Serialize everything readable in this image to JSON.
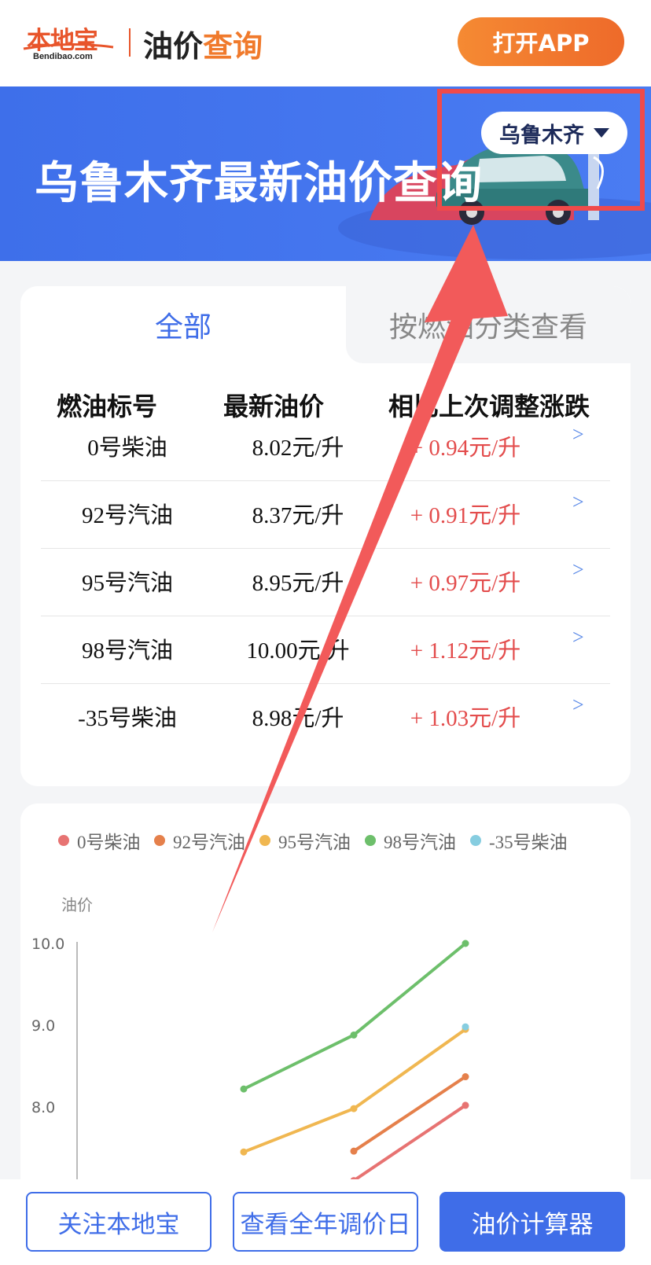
{
  "header": {
    "logo_text": "本地宝",
    "logo_sub": "Bendibao.com",
    "title_plain": "油价",
    "title_accent": "查询",
    "open_app_label": "打开APP"
  },
  "banner": {
    "title": "乌鲁木齐最新油价查询",
    "city_select": "乌鲁木齐"
  },
  "tabs": [
    {
      "label": "全部",
      "active": true
    },
    {
      "label": "按燃油分类查看",
      "active": false
    }
  ],
  "table": {
    "headers": [
      "燃油标号",
      "最新油价",
      "相比上次调整涨跌"
    ],
    "rows": [
      {
        "name": "0号柴油",
        "price": "8.02元/升",
        "change": "+ 0.94元/升",
        "arrow": ">"
      },
      {
        "name": "92号汽油",
        "price": "8.37元/升",
        "change": "+ 0.91元/升",
        "arrow": ">"
      },
      {
        "name": "95号汽油",
        "price": "8.95元/升",
        "change": "+ 0.97元/升",
        "arrow": ">"
      },
      {
        "name": "98号汽油",
        "price": "10.00元/升",
        "change": "+ 1.12元/升",
        "arrow": ">"
      },
      {
        "name": "-35号柴油",
        "price": "8.98元/升",
        "change": "+ 1.03元/升",
        "arrow": ">"
      }
    ]
  },
  "chart_data": {
    "type": "line",
    "ylabel": "油价",
    "ylim": [
      7.5,
      10.0
    ],
    "yticks": [
      "10.0",
      "9.0",
      "8.0"
    ],
    "x": [
      1,
      2,
      3
    ],
    "legend_position": "top",
    "series": [
      {
        "name": "0号柴油",
        "color": "#e77372",
        "values": [
          null,
          7.1,
          8.02
        ]
      },
      {
        "name": "92号汽油",
        "color": "#e5804b",
        "values": [
          null,
          7.46,
          8.37
        ]
      },
      {
        "name": "95号汽油",
        "color": "#f0b751",
        "values": [
          7.45,
          7.98,
          8.95
        ]
      },
      {
        "name": "98号汽油",
        "color": "#6dbf6b",
        "values": [
          8.22,
          8.88,
          10.0
        ]
      },
      {
        "name": "-35号柴油",
        "color": "#86cde0",
        "values": [
          null,
          null,
          8.98
        ]
      }
    ]
  },
  "bottom_bar": {
    "follow_label": "关注本地宝",
    "days_label": "查看全年调价日",
    "calc_label": "油价计算器"
  },
  "annotation": {
    "highlight_color": "#f04a4a"
  }
}
